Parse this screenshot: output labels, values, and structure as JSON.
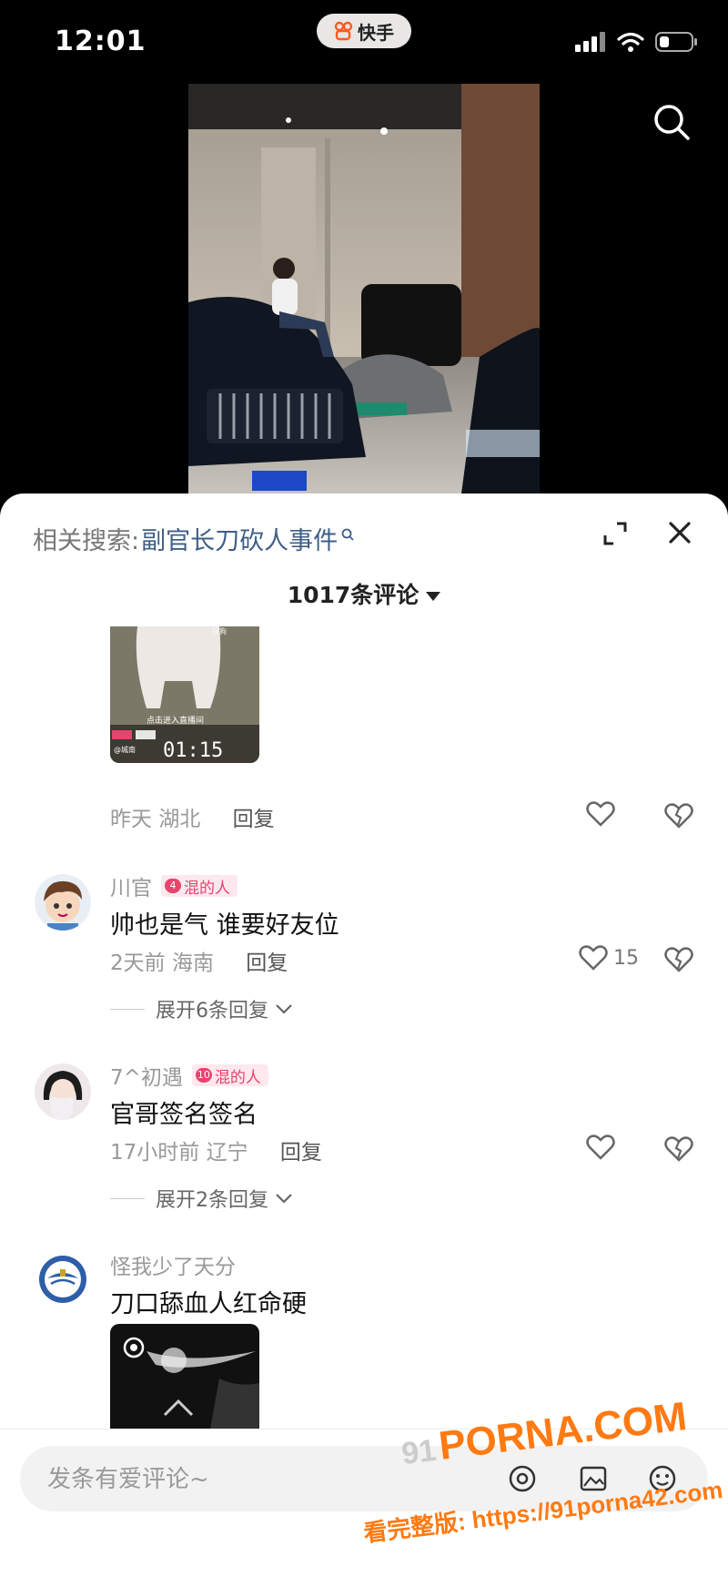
{
  "status_bar": {
    "time": "12:01",
    "app_name": "快手"
  },
  "related_search": {
    "label": "相关搜索:",
    "query": "副官长刀砍人事件"
  },
  "comments_header": {
    "count_label": "1017条评论"
  },
  "comments": [
    {
      "meta_time": "昨天",
      "meta_location": "湖北",
      "reply_label": "回复",
      "likes": ""
    },
    {
      "username": "川官",
      "badge_level": "4",
      "badge_text": "混的人",
      "text": "帅也是气  谁要好友位",
      "meta_time": "2天前",
      "meta_location": "海南",
      "reply_label": "回复",
      "likes": "15",
      "expand_label": "展开6条回复"
    },
    {
      "username": "7^初遇",
      "badge_level": "10",
      "badge_text": "混的人",
      "text": "官哥签名签名",
      "meta_time": "17小时前",
      "meta_location": "辽宁",
      "reply_label": "回复",
      "likes": "",
      "expand_label": "展开2条回复"
    },
    {
      "username": "怪我少了天分",
      "text": "刀口舔血人红命硬"
    }
  ],
  "thumb_overlay": {
    "timer": "01:15",
    "hint": "点击进入直播间"
  },
  "input": {
    "placeholder": "发条有爱评论~"
  },
  "watermark": {
    "prefix": "91",
    "site": "PORNA.COM",
    "line2": "看完整版: https://91porna42.com"
  },
  "icons": [
    "search-icon",
    "expand-icon",
    "close-icon",
    "heart-icon",
    "broken-heart-icon",
    "chevron-down-icon",
    "emoji-icon",
    "image-icon",
    "at-icon"
  ],
  "colors": {
    "accent_pink": "#e8436e",
    "link_blue": "#3f5f86",
    "watermark_orange": "#ff7a12"
  }
}
